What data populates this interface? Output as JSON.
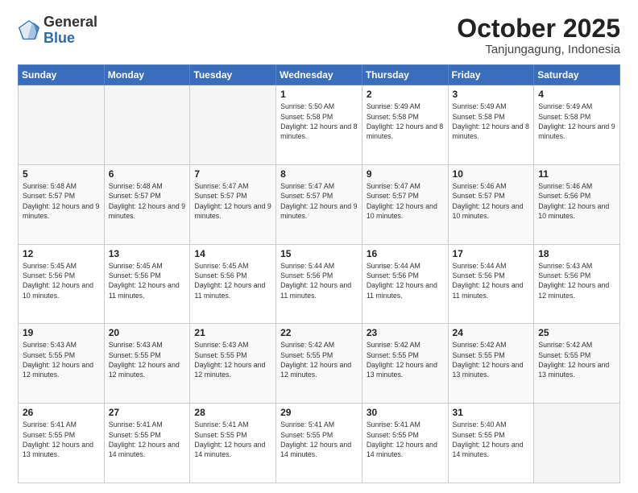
{
  "logo": {
    "general": "General",
    "blue": "Blue"
  },
  "title": "October 2025",
  "subtitle": "Tanjungagung, Indonesia",
  "weekdays": [
    "Sunday",
    "Monday",
    "Tuesday",
    "Wednesday",
    "Thursday",
    "Friday",
    "Saturday"
  ],
  "weeks": [
    [
      {
        "day": "",
        "info": ""
      },
      {
        "day": "",
        "info": ""
      },
      {
        "day": "",
        "info": ""
      },
      {
        "day": "1",
        "info": "Sunrise: 5:50 AM\nSunset: 5:58 PM\nDaylight: 12 hours\nand 8 minutes."
      },
      {
        "day": "2",
        "info": "Sunrise: 5:49 AM\nSunset: 5:58 PM\nDaylight: 12 hours\nand 8 minutes."
      },
      {
        "day": "3",
        "info": "Sunrise: 5:49 AM\nSunset: 5:58 PM\nDaylight: 12 hours\nand 8 minutes."
      },
      {
        "day": "4",
        "info": "Sunrise: 5:49 AM\nSunset: 5:58 PM\nDaylight: 12 hours\nand 9 minutes."
      }
    ],
    [
      {
        "day": "5",
        "info": "Sunrise: 5:48 AM\nSunset: 5:57 PM\nDaylight: 12 hours\nand 9 minutes."
      },
      {
        "day": "6",
        "info": "Sunrise: 5:48 AM\nSunset: 5:57 PM\nDaylight: 12 hours\nand 9 minutes."
      },
      {
        "day": "7",
        "info": "Sunrise: 5:47 AM\nSunset: 5:57 PM\nDaylight: 12 hours\nand 9 minutes."
      },
      {
        "day": "8",
        "info": "Sunrise: 5:47 AM\nSunset: 5:57 PM\nDaylight: 12 hours\nand 9 minutes."
      },
      {
        "day": "9",
        "info": "Sunrise: 5:47 AM\nSunset: 5:57 PM\nDaylight: 12 hours\nand 10 minutes."
      },
      {
        "day": "10",
        "info": "Sunrise: 5:46 AM\nSunset: 5:57 PM\nDaylight: 12 hours\nand 10 minutes."
      },
      {
        "day": "11",
        "info": "Sunrise: 5:46 AM\nSunset: 5:56 PM\nDaylight: 12 hours\nand 10 minutes."
      }
    ],
    [
      {
        "day": "12",
        "info": "Sunrise: 5:45 AM\nSunset: 5:56 PM\nDaylight: 12 hours\nand 10 minutes."
      },
      {
        "day": "13",
        "info": "Sunrise: 5:45 AM\nSunset: 5:56 PM\nDaylight: 12 hours\nand 11 minutes."
      },
      {
        "day": "14",
        "info": "Sunrise: 5:45 AM\nSunset: 5:56 PM\nDaylight: 12 hours\nand 11 minutes."
      },
      {
        "day": "15",
        "info": "Sunrise: 5:44 AM\nSunset: 5:56 PM\nDaylight: 12 hours\nand 11 minutes."
      },
      {
        "day": "16",
        "info": "Sunrise: 5:44 AM\nSunset: 5:56 PM\nDaylight: 12 hours\nand 11 minutes."
      },
      {
        "day": "17",
        "info": "Sunrise: 5:44 AM\nSunset: 5:56 PM\nDaylight: 12 hours\nand 11 minutes."
      },
      {
        "day": "18",
        "info": "Sunrise: 5:43 AM\nSunset: 5:56 PM\nDaylight: 12 hours\nand 12 minutes."
      }
    ],
    [
      {
        "day": "19",
        "info": "Sunrise: 5:43 AM\nSunset: 5:55 PM\nDaylight: 12 hours\nand 12 minutes."
      },
      {
        "day": "20",
        "info": "Sunrise: 5:43 AM\nSunset: 5:55 PM\nDaylight: 12 hours\nand 12 minutes."
      },
      {
        "day": "21",
        "info": "Sunrise: 5:43 AM\nSunset: 5:55 PM\nDaylight: 12 hours\nand 12 minutes."
      },
      {
        "day": "22",
        "info": "Sunrise: 5:42 AM\nSunset: 5:55 PM\nDaylight: 12 hours\nand 12 minutes."
      },
      {
        "day": "23",
        "info": "Sunrise: 5:42 AM\nSunset: 5:55 PM\nDaylight: 12 hours\nand 13 minutes."
      },
      {
        "day": "24",
        "info": "Sunrise: 5:42 AM\nSunset: 5:55 PM\nDaylight: 12 hours\nand 13 minutes."
      },
      {
        "day": "25",
        "info": "Sunrise: 5:42 AM\nSunset: 5:55 PM\nDaylight: 12 hours\nand 13 minutes."
      }
    ],
    [
      {
        "day": "26",
        "info": "Sunrise: 5:41 AM\nSunset: 5:55 PM\nDaylight: 12 hours\nand 13 minutes."
      },
      {
        "day": "27",
        "info": "Sunrise: 5:41 AM\nSunset: 5:55 PM\nDaylight: 12 hours\nand 14 minutes."
      },
      {
        "day": "28",
        "info": "Sunrise: 5:41 AM\nSunset: 5:55 PM\nDaylight: 12 hours\nand 14 minutes."
      },
      {
        "day": "29",
        "info": "Sunrise: 5:41 AM\nSunset: 5:55 PM\nDaylight: 12 hours\nand 14 minutes."
      },
      {
        "day": "30",
        "info": "Sunrise: 5:41 AM\nSunset: 5:55 PM\nDaylight: 12 hours\nand 14 minutes."
      },
      {
        "day": "31",
        "info": "Sunrise: 5:40 AM\nSunset: 5:55 PM\nDaylight: 12 hours\nand 14 minutes."
      },
      {
        "day": "",
        "info": ""
      }
    ]
  ]
}
